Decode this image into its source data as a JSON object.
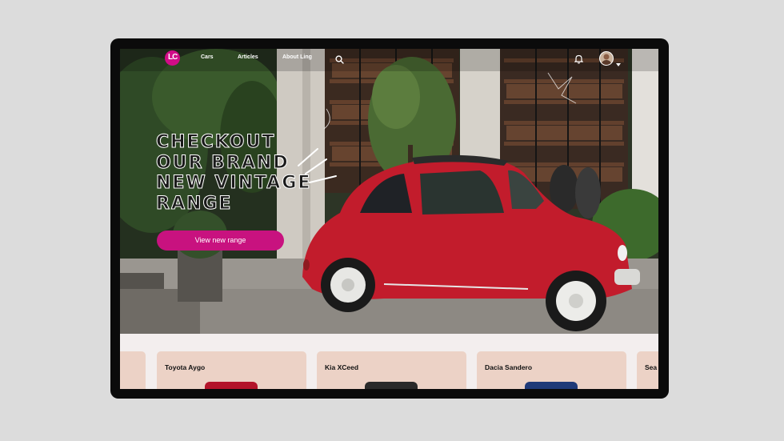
{
  "nav": {
    "logo_text": "LC",
    "links": [
      "Cars",
      "Articles",
      "About Ling"
    ],
    "icons": [
      "search-icon",
      "bell-icon",
      "avatar",
      "chevron-down-icon"
    ]
  },
  "hero": {
    "headline_lines": [
      "CHECKOUT",
      "OUR BRAND",
      "NEW VINTAGE",
      "RANGE"
    ],
    "cta_label": "View new range"
  },
  "cards": [
    {
      "title": ""
    },
    {
      "title": "Toyota Aygo"
    },
    {
      "title": "Kia XCeed"
    },
    {
      "title": "Dacia Sandero"
    },
    {
      "title": "Sea"
    }
  ],
  "colors": {
    "brand": "#d10c87",
    "cta": "#c8127f",
    "card_bg": "#ecd2c6",
    "page_bg": "#dcdcdc"
  }
}
